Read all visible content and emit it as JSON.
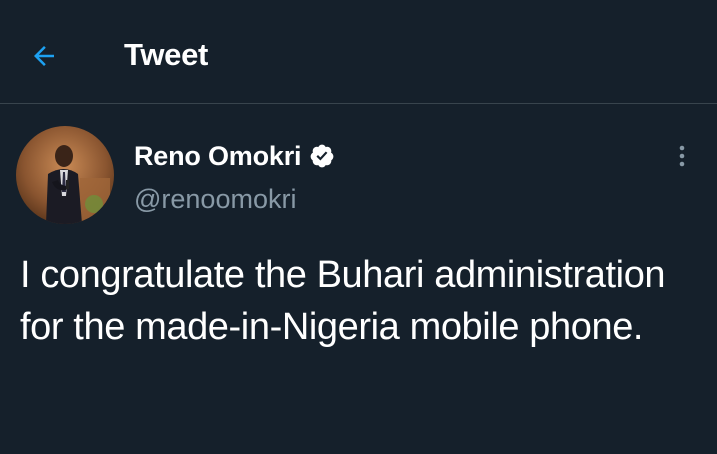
{
  "header": {
    "back_icon": "arrow-left-icon",
    "title": "Tweet"
  },
  "tweet": {
    "author": {
      "name": "Reno Omokri",
      "handle": "@renoomokri",
      "verified": true,
      "verified_icon": "verified-badge-icon",
      "avatar_icon": "profile-photo"
    },
    "more_icon": "vertical-ellipsis-icon",
    "text": "I congratulate the Buhari administration for the made-in-Nigeria mobile phone."
  },
  "colors": {
    "background": "#15202b",
    "accent": "#1da1f2",
    "text_primary": "#ffffff",
    "text_secondary": "#8899a6",
    "divider": "#38444d"
  }
}
